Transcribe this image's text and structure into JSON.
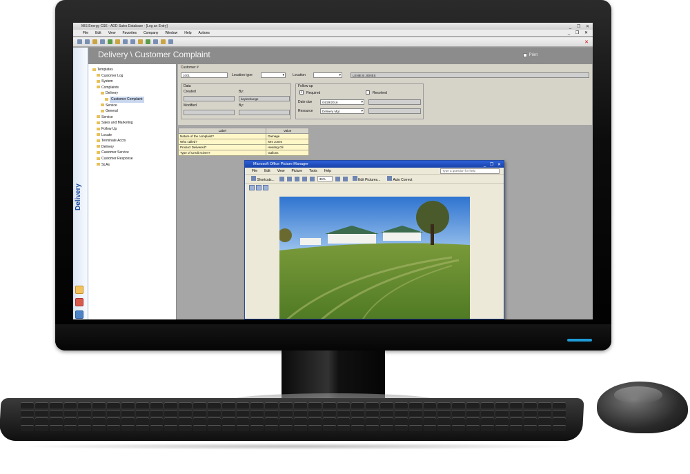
{
  "app": {
    "window_title": "MIS Energy CSE - ADD Sales Database - [Log an Entry]",
    "menus": [
      "File",
      "Edit",
      "View",
      "Favorites",
      "Company",
      "Window",
      "Help",
      "Actions"
    ]
  },
  "nav": {
    "section_label": "Delivery"
  },
  "page": {
    "title": "Delivery \\ Customer Complaint",
    "print_label": "Print"
  },
  "tree": {
    "items": [
      {
        "label": "Templates",
        "level": 0
      },
      {
        "label": "Customer Log",
        "level": 1
      },
      {
        "label": "System",
        "level": 1
      },
      {
        "label": "Complaints",
        "level": 1
      },
      {
        "label": "Delivery",
        "level": 2
      },
      {
        "label": "Customer Complaint",
        "level": 3,
        "selected": true
      },
      {
        "label": "Service",
        "level": 2
      },
      {
        "label": "General",
        "level": 2
      },
      {
        "label": "Service",
        "level": 1
      },
      {
        "label": "Sales and Marketing",
        "level": 1
      },
      {
        "label": "Follow Up",
        "level": 1
      },
      {
        "label": "Locate",
        "level": 1
      },
      {
        "label": "Terminate Accts",
        "level": 1
      },
      {
        "label": "Delivery",
        "level": 1
      },
      {
        "label": "Customer Service",
        "level": 1
      },
      {
        "label": "Customer Response",
        "level": 1
      },
      {
        "label": "SLAs",
        "level": 1
      }
    ]
  },
  "form": {
    "customer_label": "Customer #",
    "customer_value": "1001",
    "location_type_label": "Location type",
    "location_label": "Location",
    "customer_name": "LENIE B JONES",
    "data_group": "Data",
    "created_label": "Created",
    "by_label": "By:",
    "created_by": "kayleebunge",
    "modified_label": "Modified",
    "modified_by_label": "By:",
    "followup_group": "Follow up",
    "required_label": "Required",
    "resolved_label": "Resolved",
    "date_due_label": "Date due",
    "date_due_value": "04/29/2016",
    "resource_label": "Resource",
    "resource_value": "Delivery Mgr"
  },
  "grid": {
    "headers": [
      "Label",
      "Value"
    ],
    "rows": [
      {
        "label": "Nature of the complaint?",
        "value": "Damage"
      },
      {
        "label": "Who called?",
        "value": "Mrs Jones"
      },
      {
        "label": "Product Delivered?",
        "value": "Heating Oil"
      },
      {
        "label": "Type of Credit Given?",
        "value": "Gallons"
      }
    ]
  },
  "picture_manager": {
    "title": "Microsoft Office Picture Manager",
    "menus": [
      "File",
      "Edit",
      "View",
      "Picture",
      "Tools",
      "Help"
    ],
    "help_placeholder": "Type a question for help",
    "shortcuts_label": "Shortcuts...",
    "zoom": "36%",
    "edit_pictures_label": "Edit Pictures...",
    "auto_correct_label": "Auto Correct"
  },
  "colors": {
    "app_gray": "#9a9a9a",
    "panel": "#d6d3c9",
    "nav_blue": "#1c4b9c",
    "xp_title": "#2c5fd8",
    "grid_yellow": "#fff7c8"
  }
}
